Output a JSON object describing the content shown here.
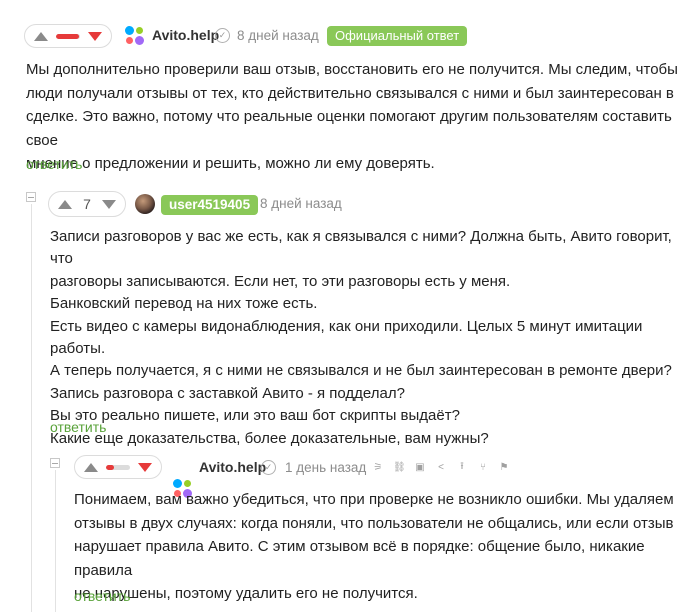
{
  "comments": [
    {
      "rating_bar": 0.95,
      "author": "Avito.help",
      "time": "8 дней назад",
      "badge": "Официальный ответ",
      "text": [
        "Мы дополнительно проверили ваш отзыв, восстановить его не получится. Мы следим, чтобы",
        "люди получали отзывы от тех, кто действительно связывался с ними и был заинтересован в",
        "сделке. Это важно, потому что реальные оценки помогают другим пользователям составить свое",
        "мнение о предложении и решить, можно ли ему доверять."
      ],
      "reply": "ответить"
    },
    {
      "rating": "7",
      "author": "user4519405",
      "time": "8 дней назад",
      "text": [
        "Записи разговоров у вас же есть, как я связывался с ними? Должна быть, Авито говорит, что",
        "разговоры записываются. Если нет, то эти разговоры есть у меня.",
        "Банковский перевод на них тоже есть.",
        "Есть видео с камеры видонаблюдения, как они приходили. Целых 5 минут имитации работы.",
        "А теперь получается, я с ними не связывался и не был заинтересован в ремонте двери?",
        "Запись разговора с заставкой Авито - я подделал?",
        "Вы это реально пишете, или это ваш бот скрипты выдаёт?",
        "Какие еще доказательства, более доказательные, вам нужны?"
      ],
      "reply": "ответить"
    },
    {
      "rating_bar": 0.35,
      "author": "Avito.help",
      "time": "1 день назад",
      "text": [
        "Понимаем, вам важно убедиться, что при проверке не возникло ошибки. Мы удаляем",
        "отзывы в двух случаях: когда поняли, что пользователи не общались, или если отзыв",
        "нарушает правила Авито. С этим отзывом всё в порядке: общение было, никакие правила",
        "не нарушены, поэтому удалить его не получится."
      ],
      "reply": "ответить",
      "tools": [
        "rss-icon",
        "link-icon",
        "save-icon",
        "share-icon",
        "arrow-up-icon",
        "branch-icon",
        "flag-icon"
      ]
    }
  ],
  "colors": {
    "accent_green": "#59a23a",
    "badge_green": "#8ac858",
    "downvote_red": "#e63a3a"
  }
}
